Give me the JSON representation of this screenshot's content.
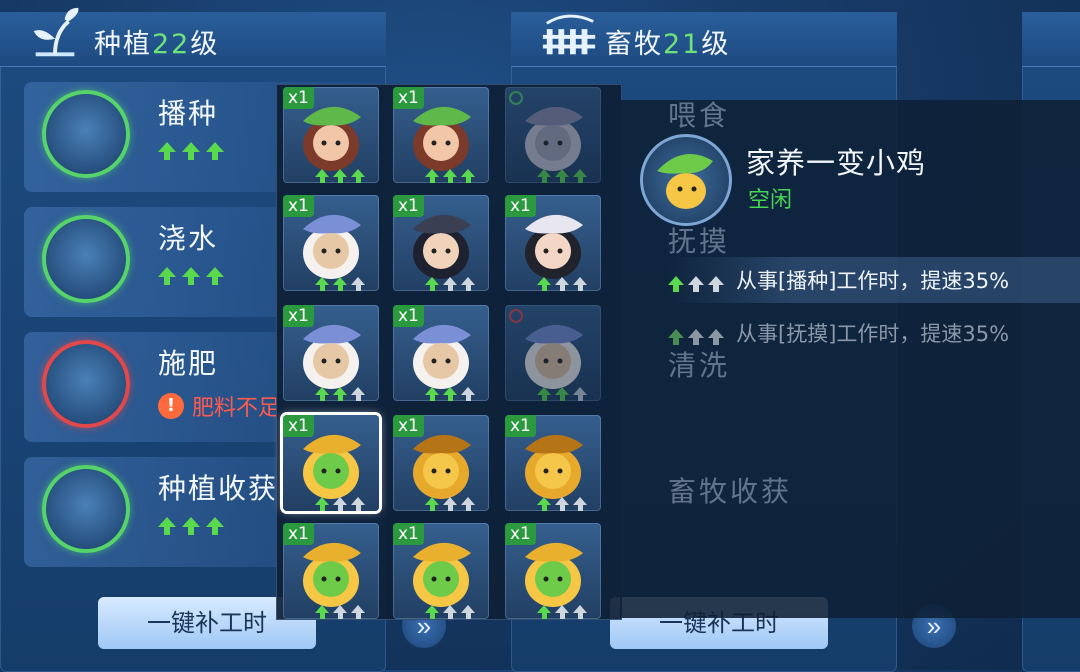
{
  "panels": [
    {
      "title": "种植",
      "level": "22",
      "level_suffix": "级",
      "jobs": [
        {
          "name": "播种",
          "arrows": [
            "green",
            "green",
            "green"
          ],
          "ring": "green"
        },
        {
          "name": "浇水",
          "arrows": [
            "green",
            "green",
            "green"
          ],
          "ring": "green"
        },
        {
          "name": "施肥",
          "warning": "肥料不足",
          "warning_icon": "!",
          "ring": "red"
        },
        {
          "name": "种植收获",
          "arrows": [
            "green",
            "green",
            "green"
          ],
          "ring": "green"
        }
      ],
      "fill_button": "一键补工时"
    },
    {
      "title": "畜牧",
      "level": "21",
      "level_suffix": "级",
      "jobs_ghost": [
        {
          "name": "喂食"
        },
        {
          "name": "抚摸"
        },
        {
          "name": "清洗"
        },
        {
          "name": "畜牧收获"
        }
      ],
      "fill_button": "一键补工时"
    }
  ],
  "picker": {
    "cells": [
      {
        "qty": "x1",
        "pet": "girl-leaf",
        "arrows": [
          "green",
          "green",
          "green"
        ]
      },
      {
        "qty": "x1",
        "pet": "girl-leaf",
        "arrows": [
          "green",
          "green",
          "green"
        ]
      },
      {
        "qty": "",
        "pet": "fox-spirit",
        "arrows": [
          "green",
          "green",
          "green"
        ],
        "status": "green",
        "dim": true
      },
      {
        "qty": "x1",
        "pet": "sheep",
        "arrows": [
          "green",
          "green",
          "gray"
        ]
      },
      {
        "qty": "x1",
        "pet": "young-man",
        "arrows": [
          "green",
          "gray",
          "gray"
        ]
      },
      {
        "qty": "x1",
        "pet": "young-woman",
        "arrows": [
          "green",
          "gray",
          "gray"
        ]
      },
      {
        "qty": "x1",
        "pet": "sheep",
        "arrows": [
          "green",
          "green",
          "gray"
        ]
      },
      {
        "qty": "x1",
        "pet": "sheep",
        "arrows": [
          "green",
          "green",
          "gray"
        ]
      },
      {
        "qty": "",
        "pet": "sheep",
        "arrows": [
          "green",
          "green",
          "gray"
        ],
        "status": "red",
        "dim": true
      },
      {
        "qty": "x1",
        "pet": "chick-leaf",
        "arrows": [
          "green",
          "gray",
          "gray"
        ],
        "selected": true
      },
      {
        "qty": "x1",
        "pet": "golden-fox",
        "arrows": [
          "green",
          "gray",
          "gray"
        ]
      },
      {
        "qty": "x1",
        "pet": "golden-fox",
        "arrows": [
          "green",
          "gray",
          "gray"
        ]
      },
      {
        "qty": "x1",
        "pet": "chick-leaf",
        "arrows": [
          "green",
          "gray",
          "gray"
        ]
      },
      {
        "qty": "x1",
        "pet": "chick-leaf",
        "arrows": [
          "green",
          "gray",
          "gray"
        ]
      },
      {
        "qty": "x1",
        "pet": "chick-leaf",
        "arrows": [
          "green",
          "gray",
          "gray"
        ]
      }
    ]
  },
  "detail": {
    "name": "家养一变小鸡",
    "status": "空闲",
    "bonuses": [
      {
        "text": "从事[播种]工作时，提速35%",
        "arrows": [
          "green",
          "gray",
          "gray"
        ],
        "active": true
      },
      {
        "text": "从事[抚摸]工作时，提速35%",
        "arrows": [
          "green",
          "gray",
          "gray"
        ],
        "active": false
      }
    ]
  },
  "colors": {
    "accent_green": "#5ad84e",
    "warning_red": "#ff5a4e",
    "level_green": "#6fe27a"
  }
}
